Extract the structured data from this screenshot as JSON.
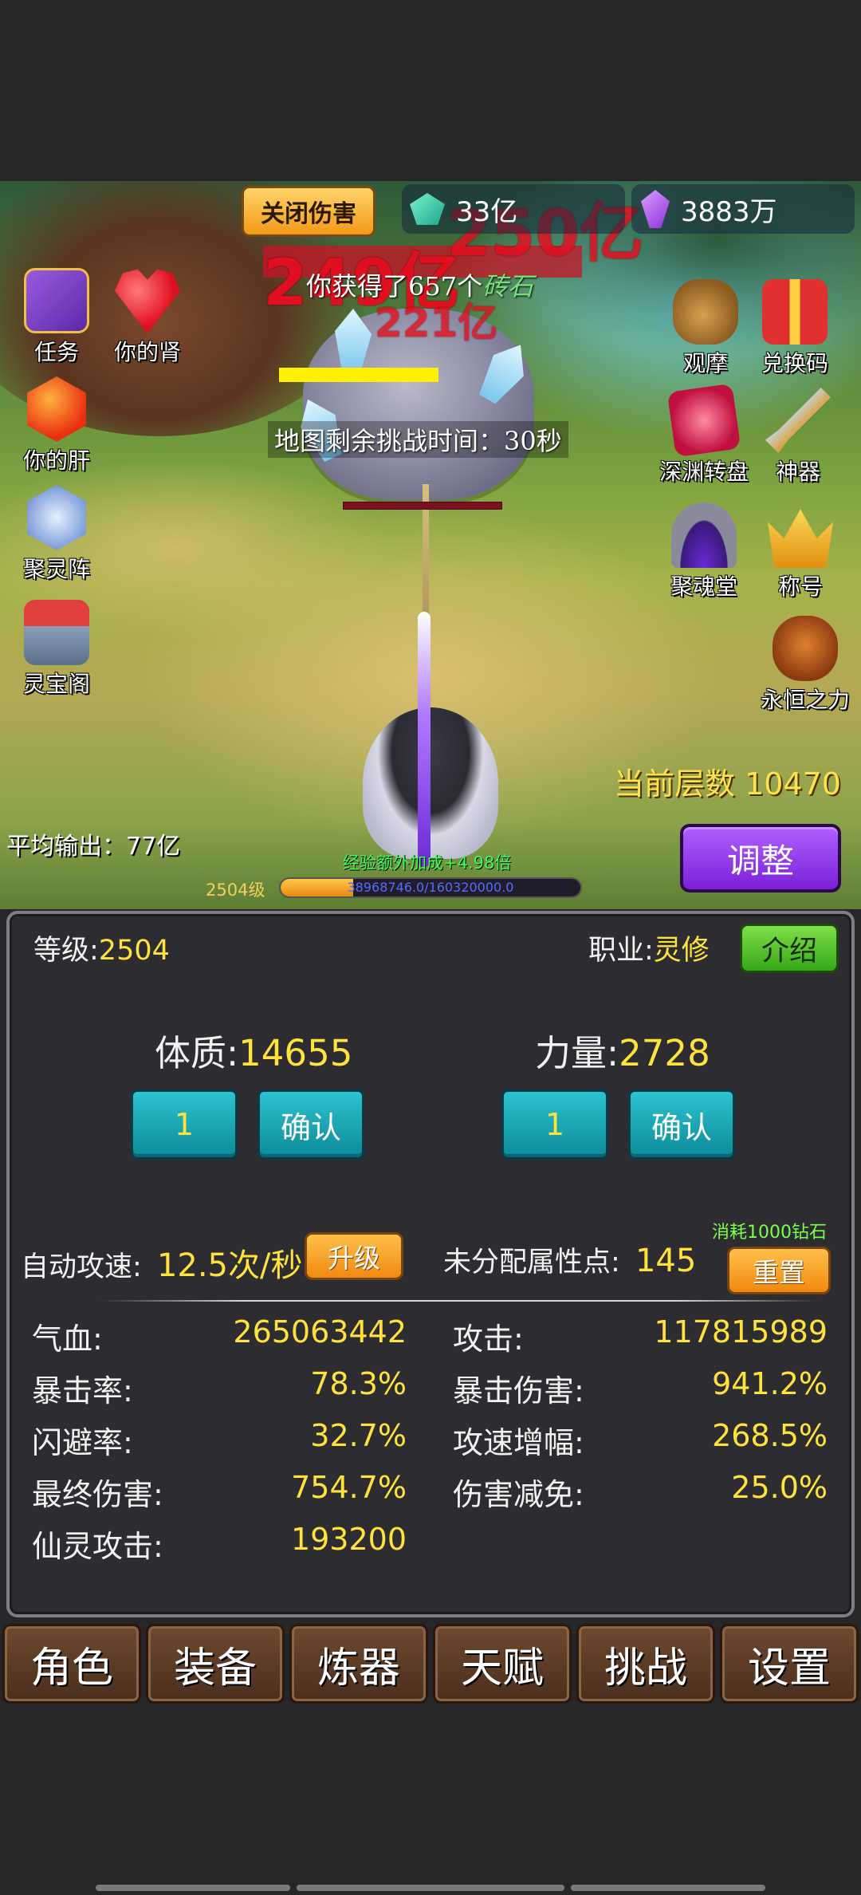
{
  "hud": {
    "close_damage_label": "关闭伤害",
    "gems_value": "33亿",
    "crystals_value": "3883万",
    "damage_float_1": "249亿",
    "damage_float_2": "250亿",
    "damage_float_3": "221亿",
    "reward_notice_prefix": "你获得了657个",
    "reward_notice_item": "砖石",
    "timer_notice": "地图剩余挑战时间：30秒"
  },
  "left_menu": [
    {
      "label": "任务",
      "icon": "quest-book-icon"
    },
    {
      "label": "你的肾",
      "icon": "heart-icon"
    },
    {
      "label": "你的肝",
      "icon": "red-crystal-icon"
    },
    {
      "label": "聚灵阵",
      "icon": "spirit-array-icon"
    },
    {
      "label": "灵宝阁",
      "icon": "shop-icon"
    }
  ],
  "right_menu": [
    {
      "label": "观摩",
      "icon": "money-bag-icon"
    },
    {
      "label": "兑换码",
      "icon": "gift-box-icon"
    },
    {
      "label": "深渊转盘",
      "icon": "abyss-wheel-icon"
    },
    {
      "label": "神器",
      "icon": "sword-icon"
    },
    {
      "label": "聚魂堂",
      "icon": "soul-gate-icon"
    },
    {
      "label": "称号",
      "icon": "crown-icon"
    },
    {
      "label": "永恒之力",
      "icon": "skull-icon"
    }
  ],
  "battle": {
    "floor_label": "当前层数 10470",
    "adjust_label": "调整",
    "avg_output": "平均输出：77亿",
    "exp_bonus": "经验额外加成+4.98倍",
    "level_small": "2504级",
    "exp_text": "38968746.0/160320000.0",
    "exp_fraction": 0.243
  },
  "panel": {
    "level_label": "等级:",
    "level_value": "2504",
    "class_label": "职业:",
    "class_value": "灵修",
    "intro_label": "介绍",
    "constitution_label": "体质:",
    "constitution_value": "14655",
    "strength_label": "力量:",
    "strength_value": "2728",
    "constitution_input": "1",
    "strength_input": "1",
    "confirm_label": "确认",
    "attack_speed_label": "自动攻速:",
    "attack_speed_value": "12.5次/秒",
    "upgrade_label": "升级",
    "unassigned_label": "未分配属性点:",
    "unassigned_value": "145",
    "reset_cost": "消耗1000钻石",
    "reset_label": "重置"
  },
  "stats_left": [
    {
      "label": "气血:",
      "value": "265063442"
    },
    {
      "label": "暴击率:",
      "value": "78.3%"
    },
    {
      "label": "闪避率:",
      "value": "32.7%"
    },
    {
      "label": "最终伤害:",
      "value": "754.7%"
    },
    {
      "label": "仙灵攻击:",
      "value": "193200"
    }
  ],
  "stats_right": [
    {
      "label": "攻击:",
      "value": "117815989"
    },
    {
      "label": "暴击伤害:",
      "value": "941.2%"
    },
    {
      "label": "攻速增幅:",
      "value": "268.5%"
    },
    {
      "label": "伤害减免:",
      "value": "25.0%"
    }
  ],
  "tabs": [
    "角色",
    "装备",
    "炼器",
    "天赋",
    "挑战",
    "设置"
  ]
}
